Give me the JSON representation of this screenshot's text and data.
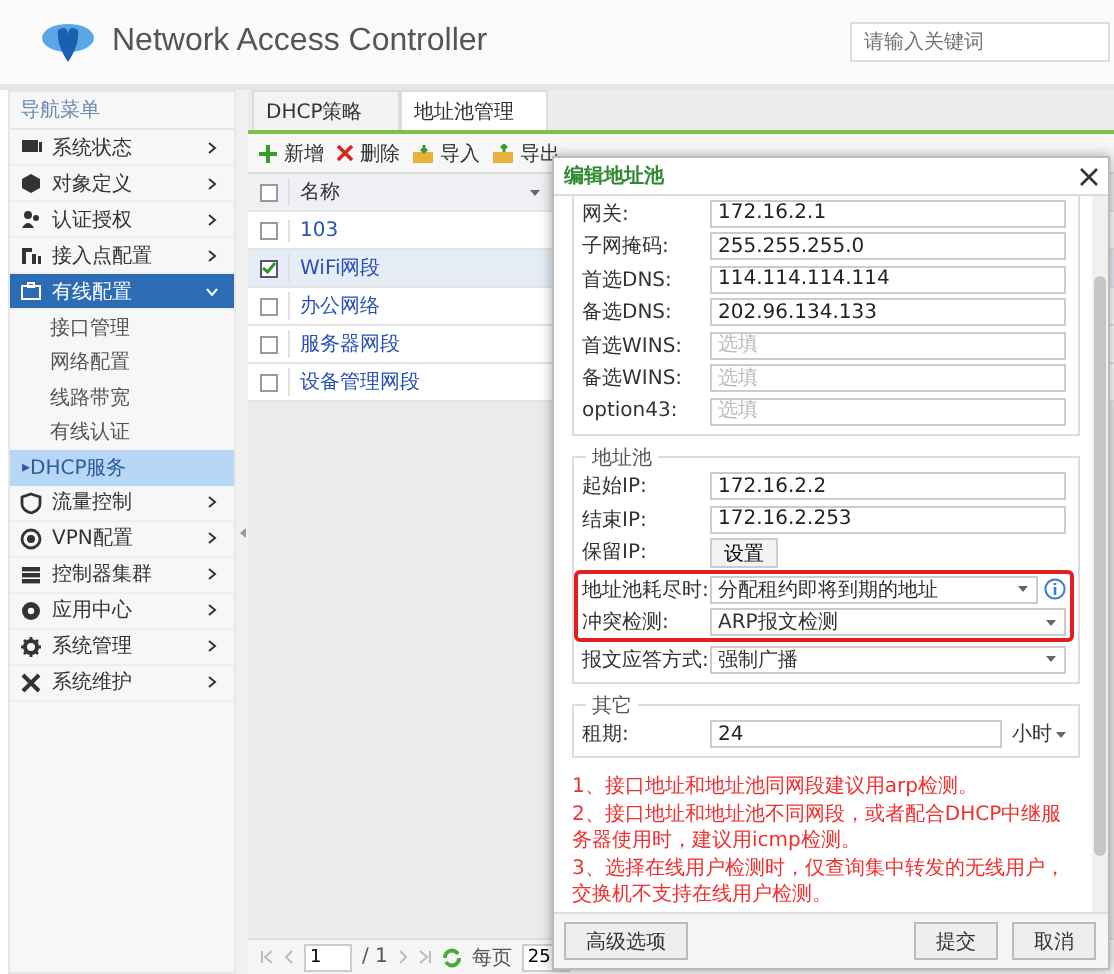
{
  "header": {
    "title": "Network Access Controller",
    "search": {
      "placeholder": "请输入关键词"
    }
  },
  "sidebar": {
    "title": "导航菜单",
    "items": [
      {
        "label": "系统状态",
        "expanded": false,
        "selected": false
      },
      {
        "label": "对象定义",
        "expanded": false,
        "selected": false
      },
      {
        "label": "认证授权",
        "expanded": false,
        "selected": false
      },
      {
        "label": "接入点配置",
        "expanded": false,
        "selected": false
      },
      {
        "label": "有线配置",
        "expanded": true,
        "selected": true,
        "children": [
          {
            "label": "接口管理",
            "selected": false
          },
          {
            "label": "网络配置",
            "selected": false
          },
          {
            "label": "线路带宽",
            "selected": false
          },
          {
            "label": "有线认证",
            "selected": false
          },
          {
            "label": "DHCP服务",
            "selected": true,
            "marker": "▸"
          }
        ]
      },
      {
        "label": "流量控制",
        "expanded": false,
        "selected": false
      },
      {
        "label": "VPN配置",
        "expanded": false,
        "selected": false
      },
      {
        "label": "控制器集群",
        "expanded": false,
        "selected": false
      },
      {
        "label": "应用中心",
        "expanded": false,
        "selected": false
      },
      {
        "label": "系统管理",
        "expanded": false,
        "selected": false
      },
      {
        "label": "系统维护",
        "expanded": false,
        "selected": false
      }
    ]
  },
  "tabs": [
    {
      "label": "DHCP策略",
      "selected": false
    },
    {
      "label": "地址池管理",
      "selected": true
    }
  ],
  "toolbar": [
    {
      "kind": "add",
      "label": "新增"
    },
    {
      "kind": "delete",
      "label": "删除"
    },
    {
      "kind": "import",
      "label": "导入"
    },
    {
      "kind": "export",
      "label": "导出"
    }
  ],
  "table": {
    "select_all": {
      "checked": false
    },
    "columns": [
      "名称"
    ],
    "rows": [
      {
        "name": "103",
        "checked": false
      },
      {
        "name": "WiFi网段",
        "checked": true
      },
      {
        "name": "办公网络",
        "checked": false
      },
      {
        "name": "服务器网段",
        "checked": false
      },
      {
        "name": "设备管理网段",
        "checked": false
      }
    ]
  },
  "pager": {
    "page": "1",
    "total": "/ 1",
    "per_page_label": "每页",
    "per_page": "25"
  },
  "dialog": {
    "title": "编辑地址池",
    "sections": [
      {
        "fields": [
          {
            "kind": "input",
            "label": "网关:",
            "value": "172.16.2.1"
          },
          {
            "kind": "input",
            "label": "子网掩码:",
            "value": "255.255.255.0"
          },
          {
            "kind": "input",
            "label": "首选DNS:",
            "value": "114.114.114.114"
          },
          {
            "kind": "input",
            "label": "备选DNS:",
            "value": "202.96.134.133"
          },
          {
            "kind": "input",
            "label": "首选WINS:",
            "placeholder": "选填"
          },
          {
            "kind": "input",
            "label": "备选WINS:",
            "placeholder": "选填"
          },
          {
            "kind": "input",
            "label": "option43:",
            "placeholder": "选填"
          }
        ]
      },
      {
        "legend": "地址池",
        "fields": [
          {
            "kind": "input",
            "label": "起始IP:",
            "value": "172.16.2.2"
          },
          {
            "kind": "input",
            "label": "结束IP:",
            "value": "172.16.2.253"
          },
          {
            "kind": "button",
            "label": "保留IP:",
            "value": "设置"
          },
          {
            "kind": "select",
            "label": "地址池耗尽时:",
            "value": "分配租约即将到期的地址",
            "info": true,
            "highlighted": true
          },
          {
            "kind": "select",
            "label": "冲突检测:",
            "value": "ARP报文检测",
            "highlighted": true
          },
          {
            "kind": "select",
            "label": "报文应答方式:",
            "value": "强制广播"
          }
        ]
      },
      {
        "legend": "其它",
        "fields": [
          {
            "kind": "unit",
            "label": "租期:",
            "value": "24",
            "unit": "小时"
          }
        ]
      }
    ],
    "notes": [
      "1、接口地址和地址池同网段建议用arp检测。",
      "2、接口地址和地址池不同网段，或者配合DHCP中继服务器使用时，建议用icmp检测。",
      "3、选择在线用户检测时，仅查询集中转发的无线用户，交换机不支持在线用户检测。"
    ],
    "left_buttons": [
      "高级选项"
    ],
    "right_buttons": [
      "提交",
      "取消"
    ]
  }
}
